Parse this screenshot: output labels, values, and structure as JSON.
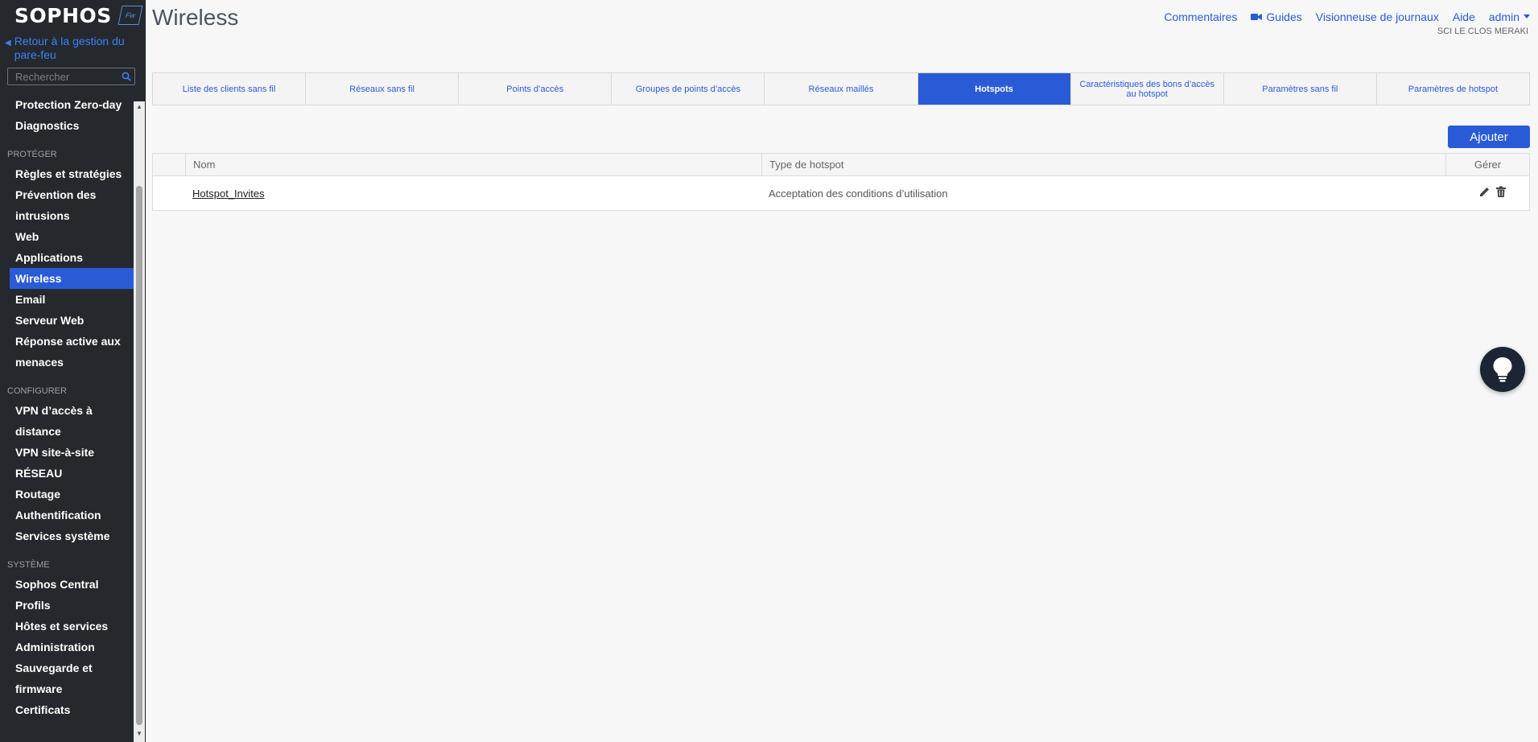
{
  "sidebar": {
    "logo_text": "SOPHOS",
    "logo_badge": "Fw",
    "back_link": "Retour à la gestion du pare-feu",
    "search_placeholder": "Rechercher",
    "items_top": [
      "Protection Zero-day",
      "Diagnostics"
    ],
    "cat_protect": "PROTÉGER",
    "items_protect": [
      "Règles et stratégies",
      "Prévention des",
      "intrusions",
      "Web",
      "Applications",
      "Wireless",
      "Email",
      "Serveur Web",
      "Réponse active aux",
      "menaces"
    ],
    "cat_configure": "CONFIGURER",
    "items_configure": [
      "VPN d’accès à",
      "distance",
      "VPN site-à-site",
      "RÉSEAU",
      "Routage",
      "Authentification",
      "Services système"
    ],
    "cat_system": "SYSTÈME",
    "items_system": [
      "Sophos Central",
      "Profils",
      "Hôtes et services",
      "Administration",
      "Sauvegarde et",
      "firmware",
      "Certificats"
    ]
  },
  "header": {
    "title": "Wireless",
    "links": {
      "comments": "Commentaires",
      "guides": "Guides",
      "log_viewer": "Visionneuse de journaux",
      "help": "Aide",
      "admin": "admin"
    },
    "org": "SCI LE CLOS MERAKI"
  },
  "tabs": [
    "Liste des clients sans fil",
    "Réseaux sans fil",
    "Points d’accès",
    "Groupes de points d’accès",
    "Réseaux maillés",
    "Hotspots",
    "Caractéristiques des bons d’accès au hotspot",
    "Paramètres sans fil",
    "Paramètres de hotspot"
  ],
  "add_button": "Ajouter",
  "table": {
    "headers": {
      "name": "Nom",
      "type": "Type de hotspot",
      "manage": "Gérer"
    },
    "rows": [
      {
        "name": "Hotspot_Invites",
        "type": "Acceptation des conditions d’utilisation"
      }
    ]
  },
  "colors": {
    "accent": "#2a5bd7",
    "sidebar_bg": "#25292d"
  }
}
